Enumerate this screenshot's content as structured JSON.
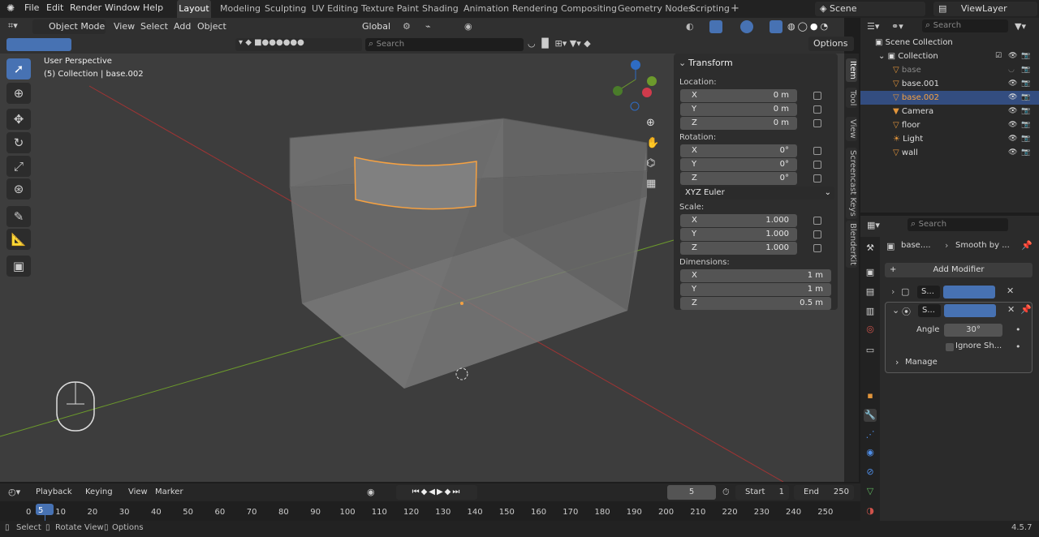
{
  "menu": {
    "file": "File",
    "edit": "Edit",
    "render": "Render",
    "window": "Window",
    "help": "Help"
  },
  "workspaces": [
    "Layout",
    "Modeling",
    "Sculpting",
    "UV Editing",
    "Texture Paint",
    "Shading",
    "Animation",
    "Rendering",
    "Compositing",
    "Geometry Nodes",
    "Scripting"
  ],
  "top_right": {
    "scene": "Scene",
    "viewlayer": "ViewLayer"
  },
  "viewport_header": {
    "mode": "Object Mode",
    "view": "View",
    "select": "Select",
    "add": "Add",
    "object": "Object",
    "transform": "Global",
    "search_placeholder": "Search",
    "options": "Options"
  },
  "viewport_info": {
    "perspective": "User Perspective",
    "collection": "(5) Collection | base.002"
  },
  "npanel": {
    "title": "Transform",
    "location": "Location:",
    "rotation": "Rotation:",
    "scale": "Scale:",
    "dimensions": "Dimensions:",
    "rot_mode": "XYZ Euler",
    "loc": [
      {
        "axis": "X",
        "val": "0 m"
      },
      {
        "axis": "Y",
        "val": "0 m"
      },
      {
        "axis": "Z",
        "val": "0 m"
      }
    ],
    "rot": [
      {
        "axis": "X",
        "val": "0°"
      },
      {
        "axis": "Y",
        "val": "0°"
      },
      {
        "axis": "Z",
        "val": "0°"
      }
    ],
    "scl": [
      {
        "axis": "X",
        "val": "1.000"
      },
      {
        "axis": "Y",
        "val": "1.000"
      },
      {
        "axis": "Z",
        "val": "1.000"
      }
    ],
    "dim": [
      {
        "axis": "X",
        "val": "1 m"
      },
      {
        "axis": "Y",
        "val": "1 m"
      },
      {
        "axis": "Z",
        "val": "0.5 m"
      }
    ]
  },
  "sidetabs": [
    "Item",
    "Tool",
    "View",
    "Screencast Keys",
    "BlenderKit"
  ],
  "outliner": {
    "search_placeholder": "Search",
    "scene_collection": "Scene Collection",
    "collection": "Collection",
    "items": [
      "base",
      "base.001",
      "base.002",
      "Camera",
      "floor",
      "Light",
      "wall"
    ]
  },
  "properties": {
    "search_placeholder": "Search",
    "breadcrumb_obj": "base....",
    "breadcrumb_mod": "Smooth by ...",
    "add_modifier": "Add Modifier",
    "mod1": "S...",
    "mod2": "S...",
    "angle_label": "Angle",
    "angle_value": "30°",
    "ignore": "Ignore Sh...",
    "manage": "Manage"
  },
  "timeline": {
    "playback": "Playback",
    "keying": "Keying",
    "view": "View",
    "marker": "Marker",
    "current_frame": "5",
    "start_label": "Start",
    "start": "1",
    "end_label": "End",
    "end": "250",
    "ticks": [
      "0",
      "5",
      "10",
      "20",
      "30",
      "40",
      "50",
      "60",
      "70",
      "80",
      "90",
      "100",
      "110",
      "120",
      "130",
      "140",
      "150",
      "160",
      "170",
      "180",
      "190",
      "200",
      "210",
      "220",
      "230",
      "240",
      "250"
    ]
  },
  "status": {
    "select": "Select",
    "rotate": "Rotate View",
    "options": "Options",
    "version": "4.5.7"
  },
  "colors": {
    "accent": "#4772b3",
    "selection": "#f5a142",
    "bg": "#3d3d3d"
  }
}
